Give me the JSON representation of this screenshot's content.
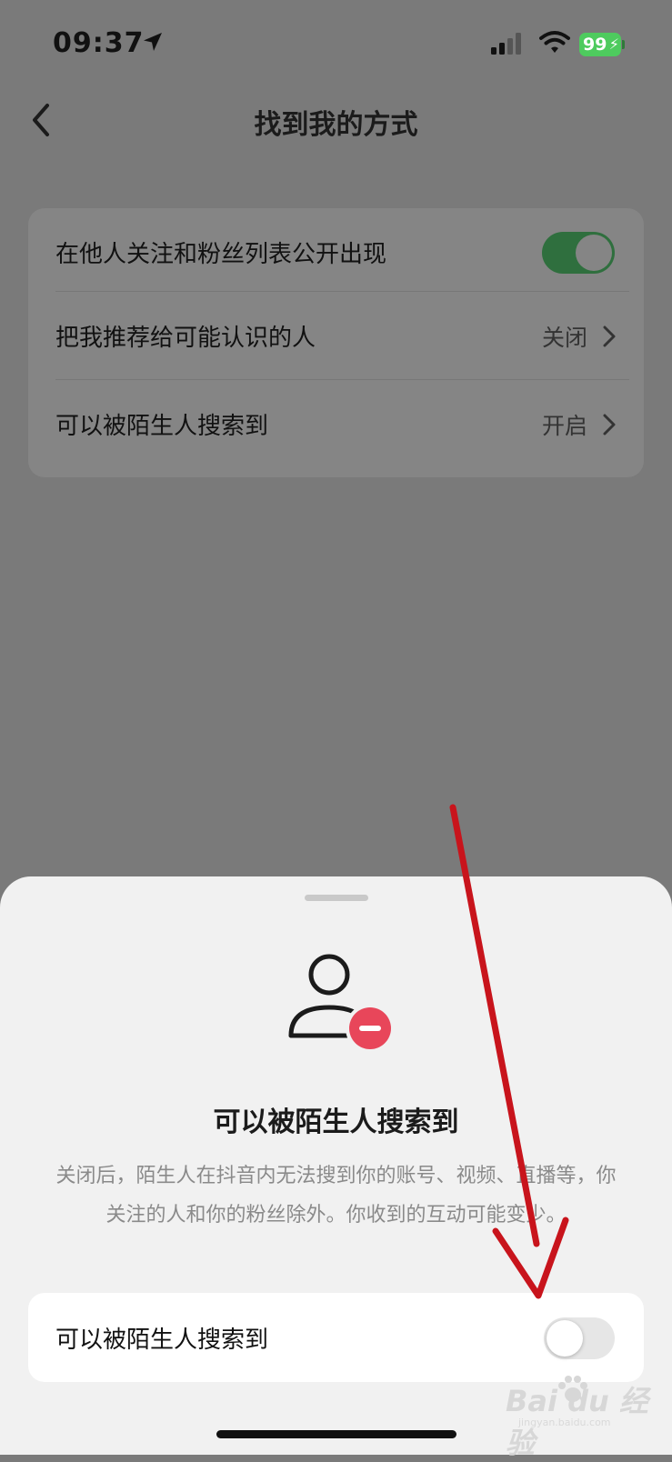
{
  "status_bar": {
    "time": "09:37",
    "battery": "99"
  },
  "nav": {
    "title": "找到我的方式"
  },
  "settings": {
    "rows": [
      {
        "label": "在他人关注和粉丝列表公开出现",
        "control": "toggle",
        "toggle_on": true
      },
      {
        "label": "把我推荐给可能认识的人",
        "value": "关闭"
      },
      {
        "label": "可以被陌生人搜索到",
        "value": "开启"
      }
    ]
  },
  "sheet": {
    "title": "可以被陌生人搜索到",
    "description": "关闭后，陌生人在抖音内无法搜到你的账号、视频、直播等，你关注的人和你的粉丝除外。你收到的互动可能变少。",
    "toggle_label": "可以被陌生人搜索到",
    "toggle_on": false
  },
  "colors": {
    "toggle_on": "#2f6f3e",
    "remove_badge": "#e8465a",
    "annotation_arrow": "#c8141c"
  },
  "watermark": {
    "brand": "Bai du 经验",
    "site": "jingyan.baidu.com"
  }
}
